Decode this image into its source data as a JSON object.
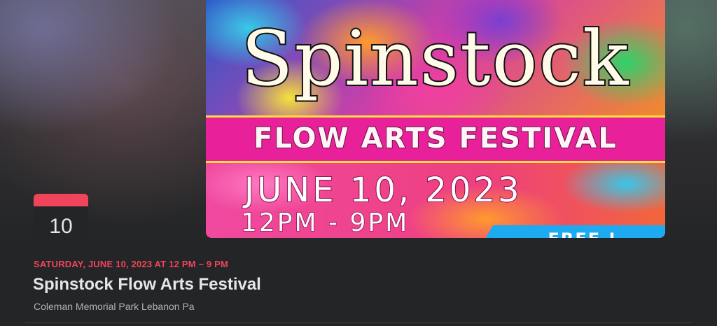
{
  "poster": {
    "title": "Spinstock",
    "subtitle": "FLOW ARTS FESTIVAL",
    "date": "JUNE 10, 2023",
    "time": "12PM - 9PM",
    "badge": "FREE !"
  },
  "calendar": {
    "day": "10",
    "accent_color": "#f0445b"
  },
  "event": {
    "datetime": "SATURDAY, JUNE 10, 2023 AT 12 PM – 9 PM",
    "title": "Spinstock Flow Arts Festival",
    "location": "Coleman Memorial Park Lebanon Pa"
  }
}
